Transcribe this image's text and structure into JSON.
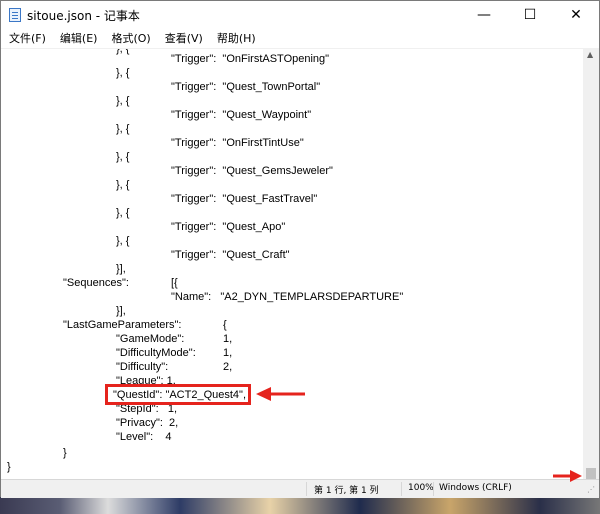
{
  "window": {
    "title": "sitoue.json - 记事本",
    "min_glyph": "—",
    "max_glyph": "☐",
    "close_glyph": "✕"
  },
  "menu": {
    "file": "文件(F)",
    "edit": "编辑(E)",
    "format": "格式(O)",
    "view": "查看(V)",
    "help": "帮助(H)"
  },
  "editor": {
    "lines": [
      "}, {",
      "\"Trigger\":  \"OnFirstASTOpening\"",
      "}, {",
      "\"Trigger\":  \"Quest_TownPortal\"",
      "}, {",
      "\"Trigger\":  \"Quest_Waypoint\"",
      "}, {",
      "\"Trigger\":  \"OnFirstTintUse\"",
      "}, {",
      "\"Trigger\":  \"Quest_GemsJeweler\"",
      "}, {",
      "\"Trigger\":  \"Quest_FastTravel\"",
      "}, {",
      "\"Trigger\":  \"Quest_Apo\"",
      "}, {",
      "\"Trigger\":  \"Quest_Craft\"",
      "}],",
      "\"Sequences\":",
      "[{",
      "\"Name\":   \"A2_DYN_TEMPLARSDEPARTURE\"",
      "}],",
      "\"LastGameParameters\":",
      "{",
      "\"GameMode\":",
      "1,",
      "\"DifficultyMode\":",
      "1,",
      "\"Difficulty\":",
      "2,",
      "\"League\": 1,",
      "\"QuestId\": \"ACT2_Quest4\",",
      "\"StepId\":   1,",
      "\"Privacy\":  2,",
      "\"Level\":    4",
      "}",
      "}"
    ]
  },
  "status": {
    "position": "第 1 行, 第 1 列",
    "zoom": "100%",
    "encoding": "Windows (CRLF)"
  },
  "colors": {
    "annotation_red": "#e5231d"
  }
}
